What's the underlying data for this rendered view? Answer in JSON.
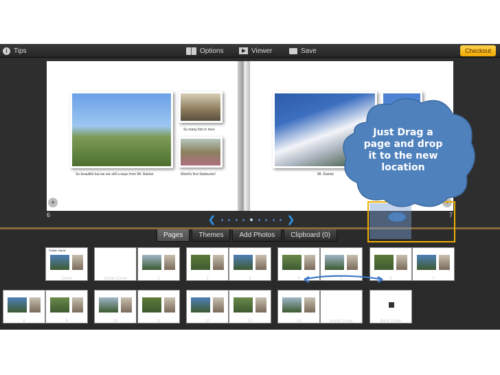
{
  "toolbar": {
    "tips": "Tips",
    "options": "Options",
    "viewer": "Viewer",
    "save": "Save",
    "checkout": "Checkout"
  },
  "spread": {
    "left": {
      "caption_main": "So beautiful but we are still a ways from Mt. Rainier",
      "caption_fish": "So many fish in here",
      "caption_starbucks": "World's first Starbucks!",
      "page_number": "6"
    },
    "right": {
      "caption_mt": "Mt. Rainier",
      "page_number": "7"
    }
  },
  "callout": {
    "line1": "Just Drag a",
    "line2": "page and drop",
    "line3": "it to the new",
    "line4": "location"
  },
  "tabs": [
    "Pages",
    "Themes",
    "Add Photos",
    "Clipboard (0)"
  ],
  "thumb_labels": {
    "row1": [
      "Cover",
      "Inside Cover",
      "1",
      "2",
      "3",
      "4",
      "5",
      "6",
      "7"
    ],
    "row2": [
      "8",
      "9",
      "10",
      "11",
      "12",
      "13",
      "14",
      "Inside Cover",
      "Back Cover"
    ]
  },
  "cover_title": "Seattle Sights",
  "colors": {
    "accent": "#2f8fe0",
    "checkout": "#f0a800",
    "bubble": "#4f81bd",
    "selection": "#f0b000"
  }
}
